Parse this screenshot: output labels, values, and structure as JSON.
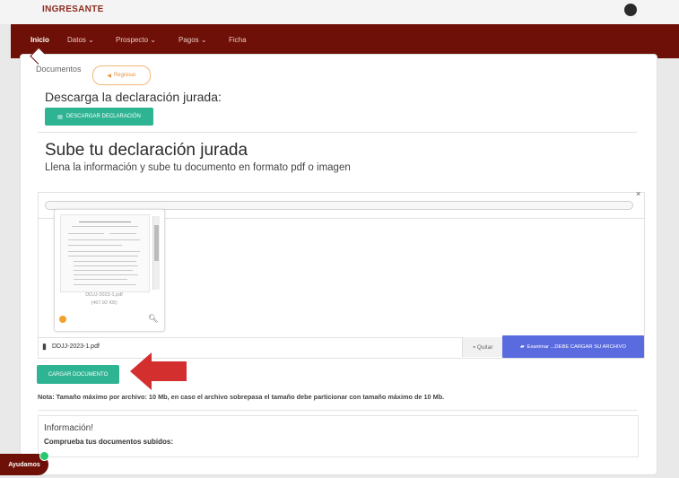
{
  "header": {
    "brand": "INGRESANTE"
  },
  "nav": {
    "items": [
      "Inicio",
      "Datos ⌄",
      "Prospecto ⌄",
      "Pagos ⌄",
      "Ficha"
    ]
  },
  "breadcrumb": {
    "label": "Documentos",
    "back_label": "Regresar"
  },
  "download": {
    "title": "Descarga la declaración jurada:",
    "button_label": "DESCARGAR DECLARACIÓN"
  },
  "upload": {
    "title": "Sube tu declaración jurada",
    "subtitle": "Llena la información y sube tu documento en formato pdf o imagen",
    "close_symbol": "×",
    "preview": {
      "file_name": "DDJJ-2023-1.pdf",
      "file_size": "(467.92 KB)"
    },
    "file_label": "DDJJ-2023-1.pdf",
    "remove_label": "Quitar",
    "browse_label": "Examinar ...DEBE CARGAR SU ARCHIVO",
    "submit_label": "CARGAR DOCUMENTO",
    "note": "Nota: Tamaño máximo por archivo: 10 Mb, en caso el archivo sobrepasa el tamaño debe particionar con tamaño máximo de 10 Mb."
  },
  "info": {
    "title": "Información!",
    "text": "Comprueba tus documentos subidos:"
  },
  "help": {
    "label": "Ayudamos"
  },
  "colors": {
    "navbar": "#6e1007",
    "teal": "#2fb493",
    "blue": "#5a6be0",
    "arrow": "#d42f2f"
  }
}
